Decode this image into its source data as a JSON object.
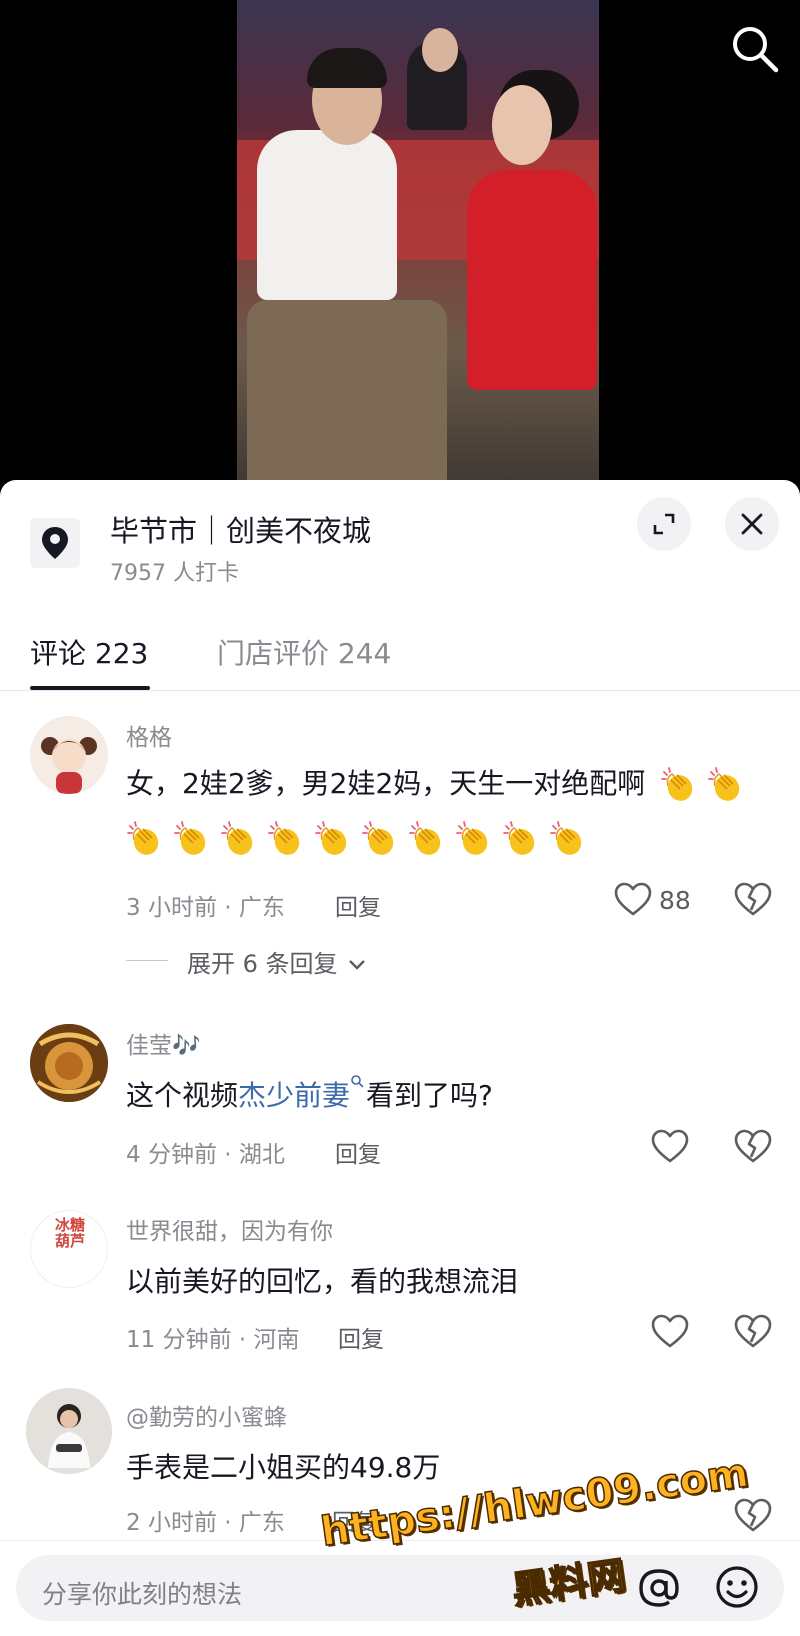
{
  "location": {
    "title": "毕节市｜创美不夜城",
    "checkins": "7957 人打卡"
  },
  "tabs": [
    {
      "label": "评论 223",
      "active": true
    },
    {
      "label": "门店评价 244",
      "active": false
    }
  ],
  "comments": [
    {
      "name": "格格",
      "text": "女，2娃2爹，男2娃2妈，天生一对绝配啊",
      "meta": "3 小时前 · 广东",
      "reply": "回复",
      "likes": "88",
      "expand": "展开 6 条回复"
    },
    {
      "name": "佳莹🎶",
      "text_before": "这个视频",
      "text_link": "杰少前妻",
      "text_after": "看到了吗?",
      "meta": "4 分钟前 · 湖北",
      "reply": "回复"
    },
    {
      "name": "世界很甜，因为有你",
      "text": "以前美好的回忆，看的我想流泪",
      "meta": "11 分钟前 · 河南",
      "reply": "回复",
      "avatar_text": "冰糖葫芦"
    },
    {
      "name": "@勤劳的小蜜蜂",
      "text": "手表是二小姐买的49.8万",
      "meta": "2 小时前 · 广东",
      "reply": "回复"
    }
  ],
  "input": {
    "placeholder": "分享你此刻的想法"
  },
  "watermark": {
    "url": "https://hlwc09.com",
    "name": "黑料网"
  },
  "icons": {
    "search": "search-icon",
    "location": "location-pin-icon",
    "fullscreen": "expand-icon",
    "close": "close-icon",
    "like": "heart-icon",
    "dislike": "broken-heart-icon",
    "at": "at-icon",
    "emoji": "emoji-icon",
    "clap": "clapping-hands-icon"
  },
  "colors": {
    "link": "#3d6aa8",
    "clap": "#f7c21b",
    "watermark": "#ffb21f"
  }
}
